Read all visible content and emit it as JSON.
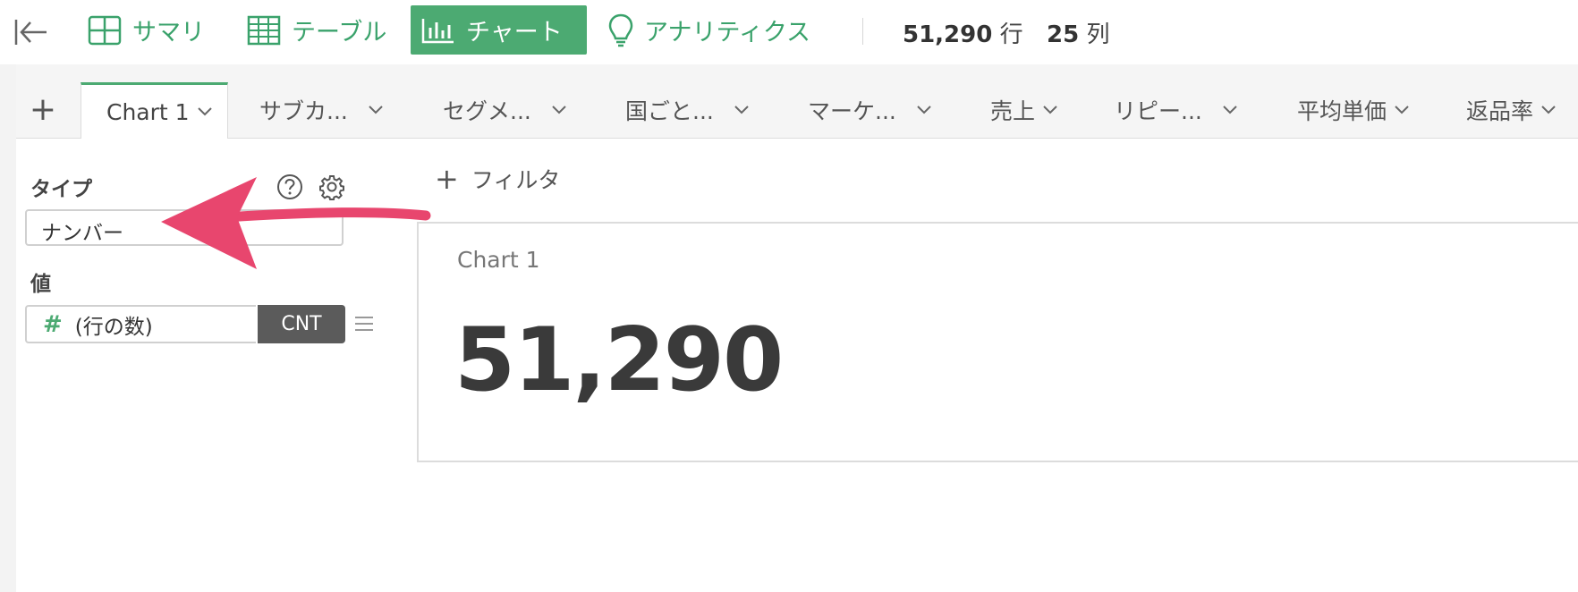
{
  "toolbar": {
    "tabs": [
      {
        "label": "サマリ",
        "icon": "grid-icon"
      },
      {
        "label": "テーブル",
        "icon": "table-icon"
      },
      {
        "label": "チャート",
        "icon": "bar-chart-icon",
        "active": true
      },
      {
        "label": "アナリティクス",
        "icon": "lightbulb-icon"
      }
    ],
    "rows_count": "51,290",
    "rows_unit": "行",
    "cols_count": "25",
    "cols_unit": "列"
  },
  "chart_tabs": {
    "add_label": "+",
    "items": [
      {
        "label": "Chart 1",
        "active": true
      },
      {
        "label": "サブカ..."
      },
      {
        "label": "セグメ..."
      },
      {
        "label": "国ごと..."
      },
      {
        "label": "マーケ..."
      },
      {
        "label": "売上"
      },
      {
        "label": "リピー..."
      },
      {
        "label": "平均単価"
      },
      {
        "label": "返品率"
      }
    ]
  },
  "config_panel": {
    "type_label": "タイプ",
    "type_value": "ナンバー",
    "value_label": "値",
    "value_field": "(行の数)",
    "aggregation": "CNT",
    "hash_symbol": "#"
  },
  "main": {
    "filter_label": "フィルタ",
    "filter_plus": "+",
    "chart_title": "Chart 1",
    "number_value": "51,290"
  },
  "colors": {
    "accent": "#4caa72",
    "arrow": "#e8466e",
    "aggregation_bg": "#5b5b5b"
  }
}
